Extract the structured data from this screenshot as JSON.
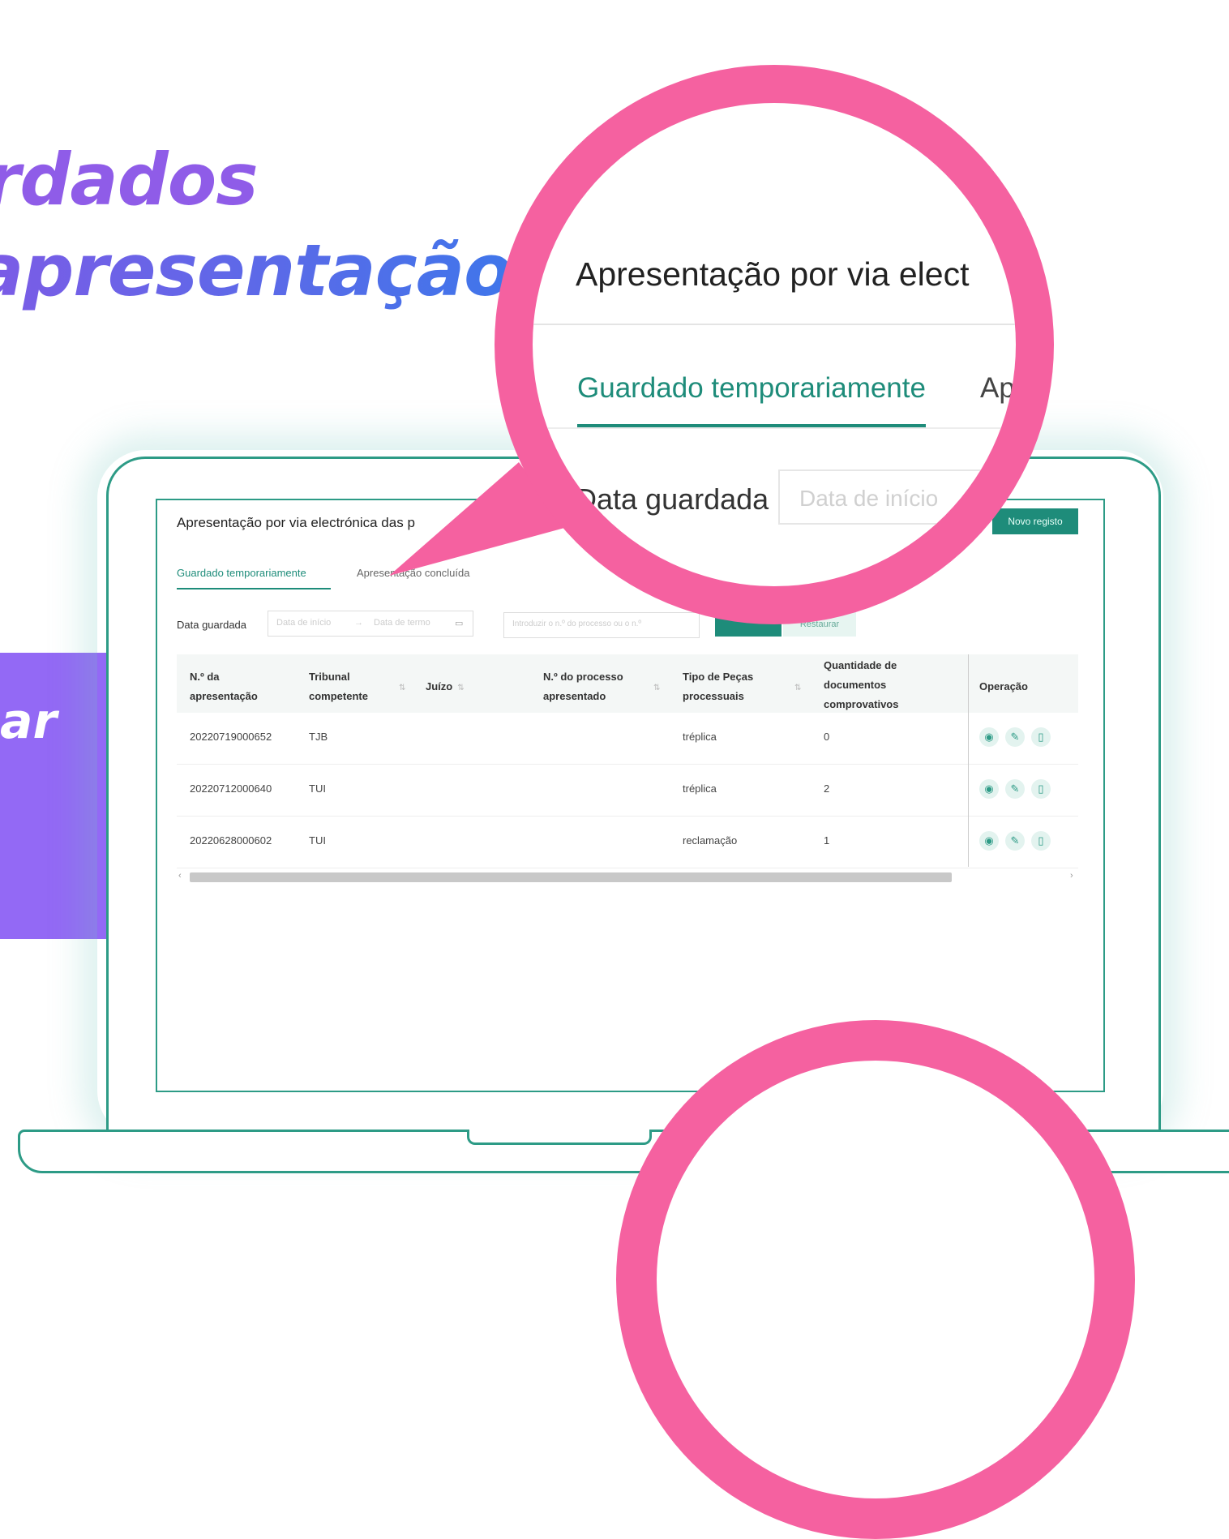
{
  "promo": {
    "line1": "rdados",
    "line2": "apresentação",
    "banner_text": "ar"
  },
  "screen": {
    "title": "Apresentação por via electrónica das p",
    "new_button": "Novo registo",
    "tabs": [
      "Guardado temporariamente",
      "Apresentação concluída"
    ],
    "filter_label": "Data guardada",
    "date_start_placeholder": "Data de início",
    "date_arrow": "→",
    "date_end_placeholder": "Data de termo",
    "process_placeholder": "Introduzir o n.º do processo ou o n.º",
    "reset_button": "Restaurar",
    "columns": [
      {
        "label_line1": "N.º da",
        "label_line2": "apresentação"
      },
      {
        "label_line1": "Tribunal",
        "label_line2": "competente"
      },
      {
        "label_line1": "Juízo",
        "label_line2": ""
      },
      {
        "label_line1": "N.º do processo",
        "label_line2": "apresentado"
      },
      {
        "label_line1": "Tipo de Peças",
        "label_line2": "processuais"
      },
      {
        "label_line1": "Quantidade de",
        "label_line2": "documentos",
        "label_line3": "comprovativos"
      },
      {
        "label_line1": "Operação",
        "label_line2": ""
      }
    ],
    "rows": [
      {
        "num": "20220719000652",
        "tribunal": "TJB",
        "juizo": "",
        "processo": "",
        "tipo": "tréplica",
        "qtd": "0"
      },
      {
        "num": "20220712000640",
        "tribunal": "TUI",
        "juizo": "",
        "processo": "",
        "tipo": "tréplica",
        "qtd": "2"
      },
      {
        "num": "20220628000602",
        "tribunal": "TUI",
        "juizo": "",
        "processo": "",
        "tipo": "reclamação",
        "qtd": "1"
      }
    ],
    "op_icons": [
      "eye-icon",
      "edit-icon",
      "trash-icon"
    ]
  },
  "magnifier": {
    "title": "Apresentação por via elect",
    "tab_active": "Guardado temporariamente",
    "tab_other": "Ap",
    "label": "Data guardada",
    "date_placeholder": "Data de início"
  },
  "colors": {
    "accent": "#1e8c7a",
    "magnifier": "#f561a0",
    "banner": "#9369f5"
  }
}
